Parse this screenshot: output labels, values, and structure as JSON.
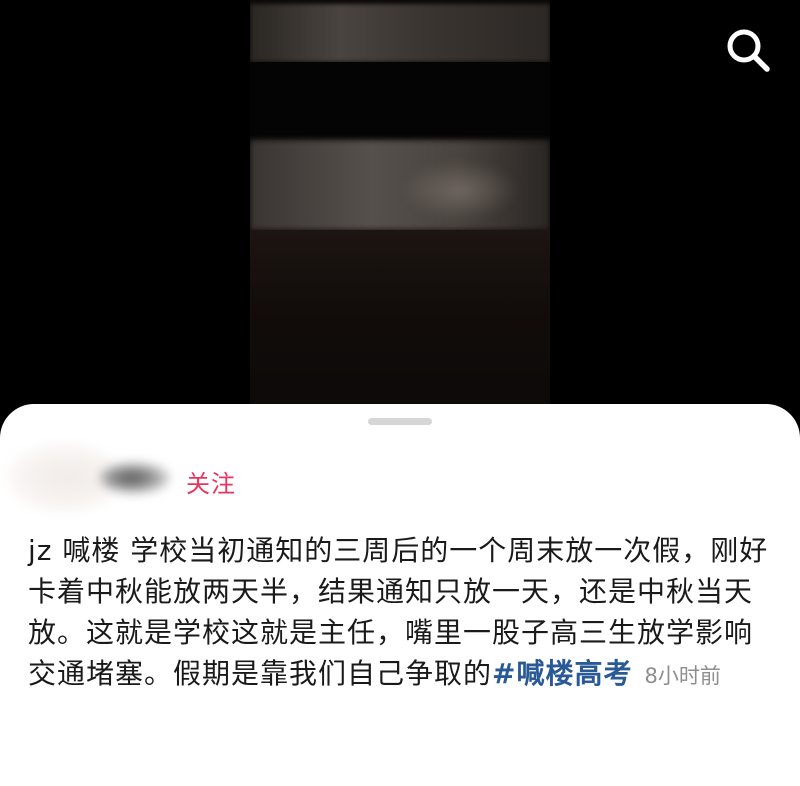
{
  "header": {
    "search_icon": "search-icon"
  },
  "post": {
    "follow_label": "关注",
    "caption_text": "jz 喊楼 学校当初通知的三周后的一个周末放一次假，刚好卡着中秋能放两天半，结果通知只放一天，还是中秋当天放。这就是学校这就是主任，嘴里一股子高三生放学影响交通堵塞。假期是靠我们自己争取的",
    "hashtag": "#喊楼高考",
    "time_ago": "8小时前"
  },
  "colors": {
    "follow": "#e8345f",
    "hashtag": "#2a5a96",
    "time": "#8e8e8e"
  }
}
